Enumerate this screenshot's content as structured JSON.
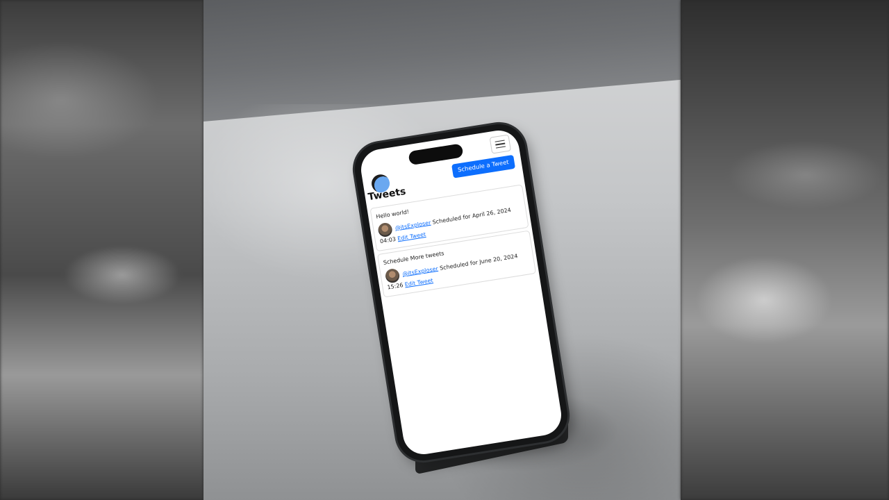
{
  "app": {
    "header": {
      "menu_icon": "hamburger-menu-icon",
      "schedule_button_label": "Schedule a Tweet"
    },
    "page_title": "Tweets",
    "tweets": [
      {
        "text": "Hello world!",
        "handle": "@itsExploser",
        "scheduled_prefix": "Scheduled for April 26,",
        "scheduled_suffix": "2024 04:03",
        "edit_label": "Edit Tweet"
      },
      {
        "text": "Schedule More tweets",
        "handle": "@itsExploser",
        "scheduled_prefix": "Scheduled for June 20,",
        "scheduled_suffix": "2024 15:26",
        "edit_label": "Edit Tweet"
      }
    ]
  },
  "colors": {
    "primary": "#0d6efd",
    "logo": "#6aa8f0"
  }
}
